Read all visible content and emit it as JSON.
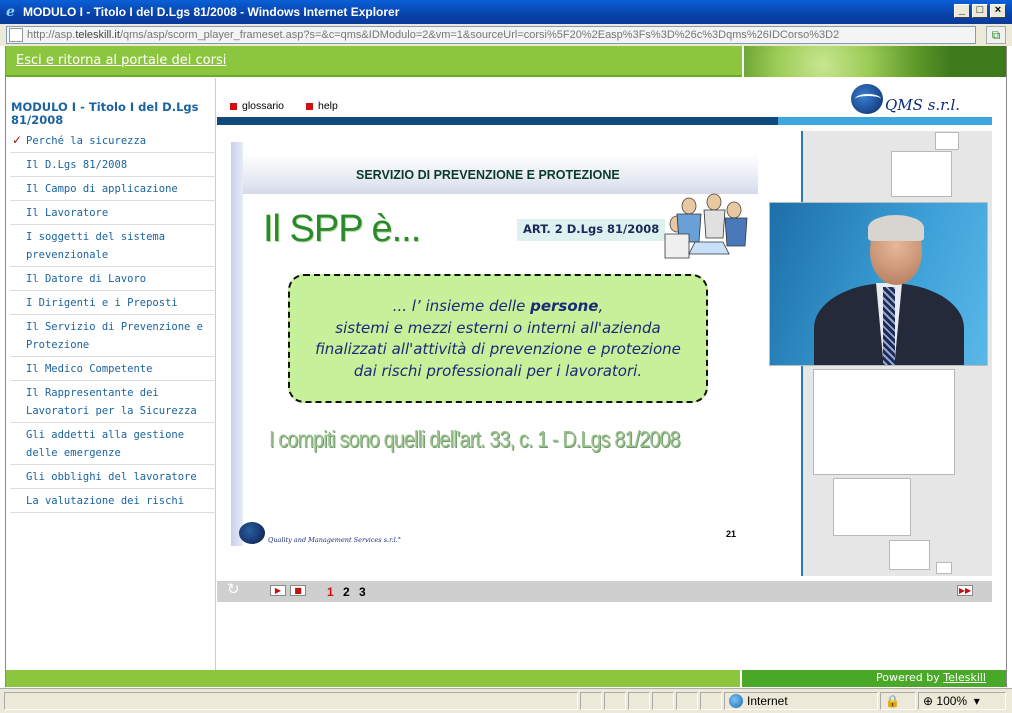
{
  "window": {
    "title": "MODULO I - Titolo I del D.Lgs 81/2008 - Windows Internet Explorer",
    "url_prefix": "http://asp.",
    "url_domain": "teleskill.it",
    "url_rest": "/qms/asp/scorm_player_frameset.asp?s=&c=qms&IDModulo=2&vm=1&sourceUrl=corsi%5F20%2Easp%3Fs%3D%26c%3Dqms%26IDCorso%3D2"
  },
  "header": {
    "exit_link": "Esci e ritorna al portale dei corsi"
  },
  "sidebar": {
    "module_title": "MODULO I - Titolo I del D.Lgs 81/2008",
    "items": [
      {
        "label": "Perché la sicurezza",
        "checked": true
      },
      {
        "label": "Il D.Lgs 81/2008"
      },
      {
        "label": "Il Campo di applicazione"
      },
      {
        "label": "Il Lavoratore"
      },
      {
        "label": "I soggetti del sistema prevenzionale"
      },
      {
        "label": "Il Datore di Lavoro"
      },
      {
        "label": "I Dirigenti e i Preposti"
      },
      {
        "label": "Il Servizio di Prevenzione e Protezione"
      },
      {
        "label": "Il Medico Competente"
      },
      {
        "label": "Il Rappresentante dei Lavoratori per la Sicurezza"
      },
      {
        "label": "Gli addetti alla gestione delle emergenze"
      },
      {
        "label": "Gli obblighi del lavoratore"
      },
      {
        "label": "La valutazione dei rischi"
      }
    ],
    "check_mark": "✓"
  },
  "toolbar": {
    "glossario": "glossario",
    "help": "help",
    "logo_text": "QMS s.r.l."
  },
  "slide": {
    "header": "SERVIZIO DI PREVENZIONE E PROTEZIONE",
    "title": "Il SPP è...",
    "article": "ART. 2 D.Lgs 81/2008",
    "def_line1_pre": "... l’ insieme delle ",
    "def_line1_bold": "persone",
    "def_line1_post": ",",
    "def_line2": "sistemi e mezzi esterni o interni all'azienda",
    "def_line3": "finalizzati all'attività di prevenzione e protezione",
    "def_line4": "dai rischi professionali per i lavoratori.",
    "compiti": "I compiti sono quelli dell'art. 33, c. 1  -  D.Lgs 81/2008",
    "footer_text": "Quality and Management Services  s.r.l.°",
    "slide_number": "21"
  },
  "player": {
    "pages": [
      "1",
      "2",
      "3"
    ],
    "current_page": "1"
  },
  "footer": {
    "powered_by": "Powered by ",
    "powered_link": "Teleskill"
  },
  "statusbar": {
    "zone": "Internet",
    "zoom": "100%"
  },
  "colors": {
    "accent_green": "#8cc63e",
    "link_blue": "#1a63a0",
    "toolbar_dark": "#0f4a7a"
  }
}
